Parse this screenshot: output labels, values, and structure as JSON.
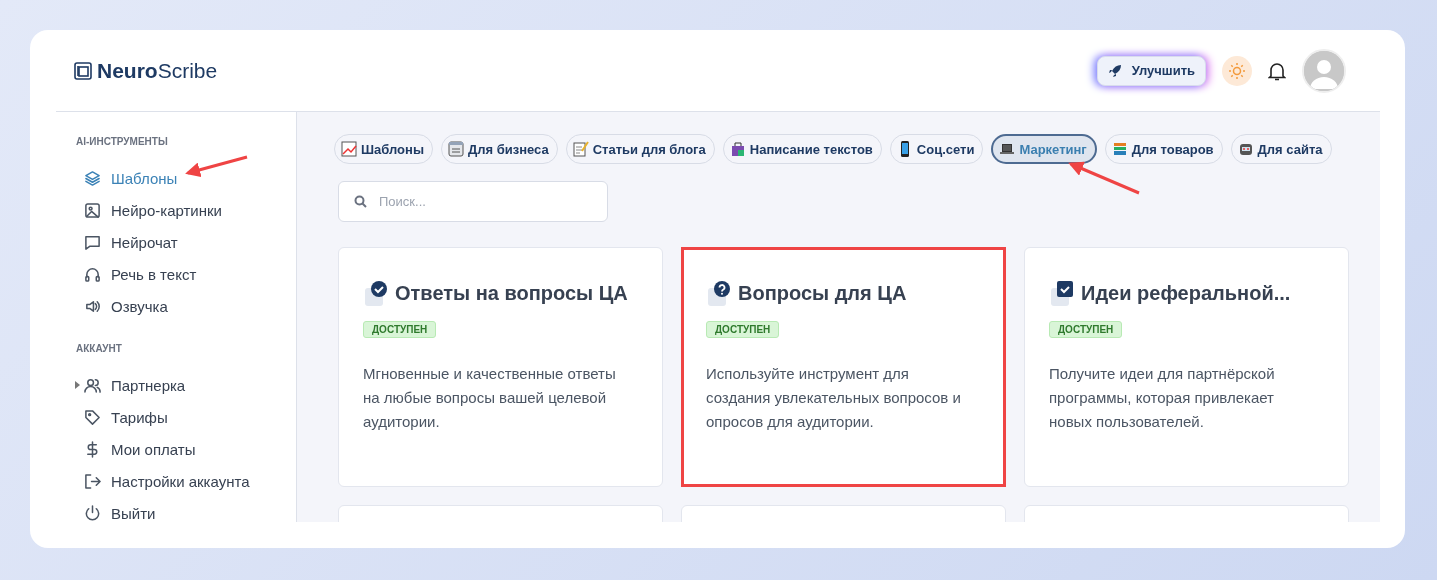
{
  "logo": {
    "bold": "Neuro",
    "rest": "Scribe"
  },
  "header": {
    "upgrade_button": "Улучшить"
  },
  "sidebar": {
    "sections": [
      {
        "title": "AI-ИНСТРУМЕНТЫ",
        "items": [
          {
            "label": "Шаблоны",
            "selected": true
          },
          {
            "label": "Нейро-картинки",
            "selected": false
          },
          {
            "label": "Нейрочат",
            "selected": false
          },
          {
            "label": "Речь в текст",
            "selected": false
          },
          {
            "label": "Озвучка",
            "selected": false
          }
        ]
      },
      {
        "title": "АККАУНТ",
        "items": [
          {
            "label": "Партнерка",
            "selected": false,
            "expanded": false
          },
          {
            "label": "Тарифы",
            "selected": false
          },
          {
            "label": "Мои оплаты",
            "selected": false
          },
          {
            "label": "Настройки аккаунта",
            "selected": false
          },
          {
            "label": "Выйти",
            "selected": false
          }
        ]
      }
    ]
  },
  "categories": [
    {
      "label": "Шаблоны",
      "selected": false
    },
    {
      "label": "Для бизнеса",
      "selected": false
    },
    {
      "label": "Статьи для блога",
      "selected": false
    },
    {
      "label": "Написание текстов",
      "selected": false
    },
    {
      "label": "Соц.сети",
      "selected": false
    },
    {
      "label": "Маркетинг",
      "selected": true
    },
    {
      "label": "Для товаров",
      "selected": false
    },
    {
      "label": "Для сайта",
      "selected": false
    }
  ],
  "search": {
    "placeholder": "Поиск..."
  },
  "cards": [
    {
      "title": "Ответы на вопросы ЦА",
      "badge": "ДОСТУПЕН",
      "description": "Мгновенные и качественные ответы на любые вопросы вашей целевой аудитории.",
      "highlighted": false
    },
    {
      "title": "Вопросы для ЦА",
      "badge": "ДОСТУПЕН",
      "description": "Используйте инструмент для создания увлекательных вопросов и опросов для аудитории.",
      "highlighted": true
    },
    {
      "title": "Идеи реферальной...",
      "badge": "ДОСТУПЕН",
      "description": "Получите идеи для партнёрской программы, которая привлекает новых пользователей.",
      "highlighted": false
    }
  ],
  "partial_cards": [
    {
      "kind": "blank"
    },
    {
      "kind": "blank"
    },
    {
      "kind": "blank"
    }
  ]
}
